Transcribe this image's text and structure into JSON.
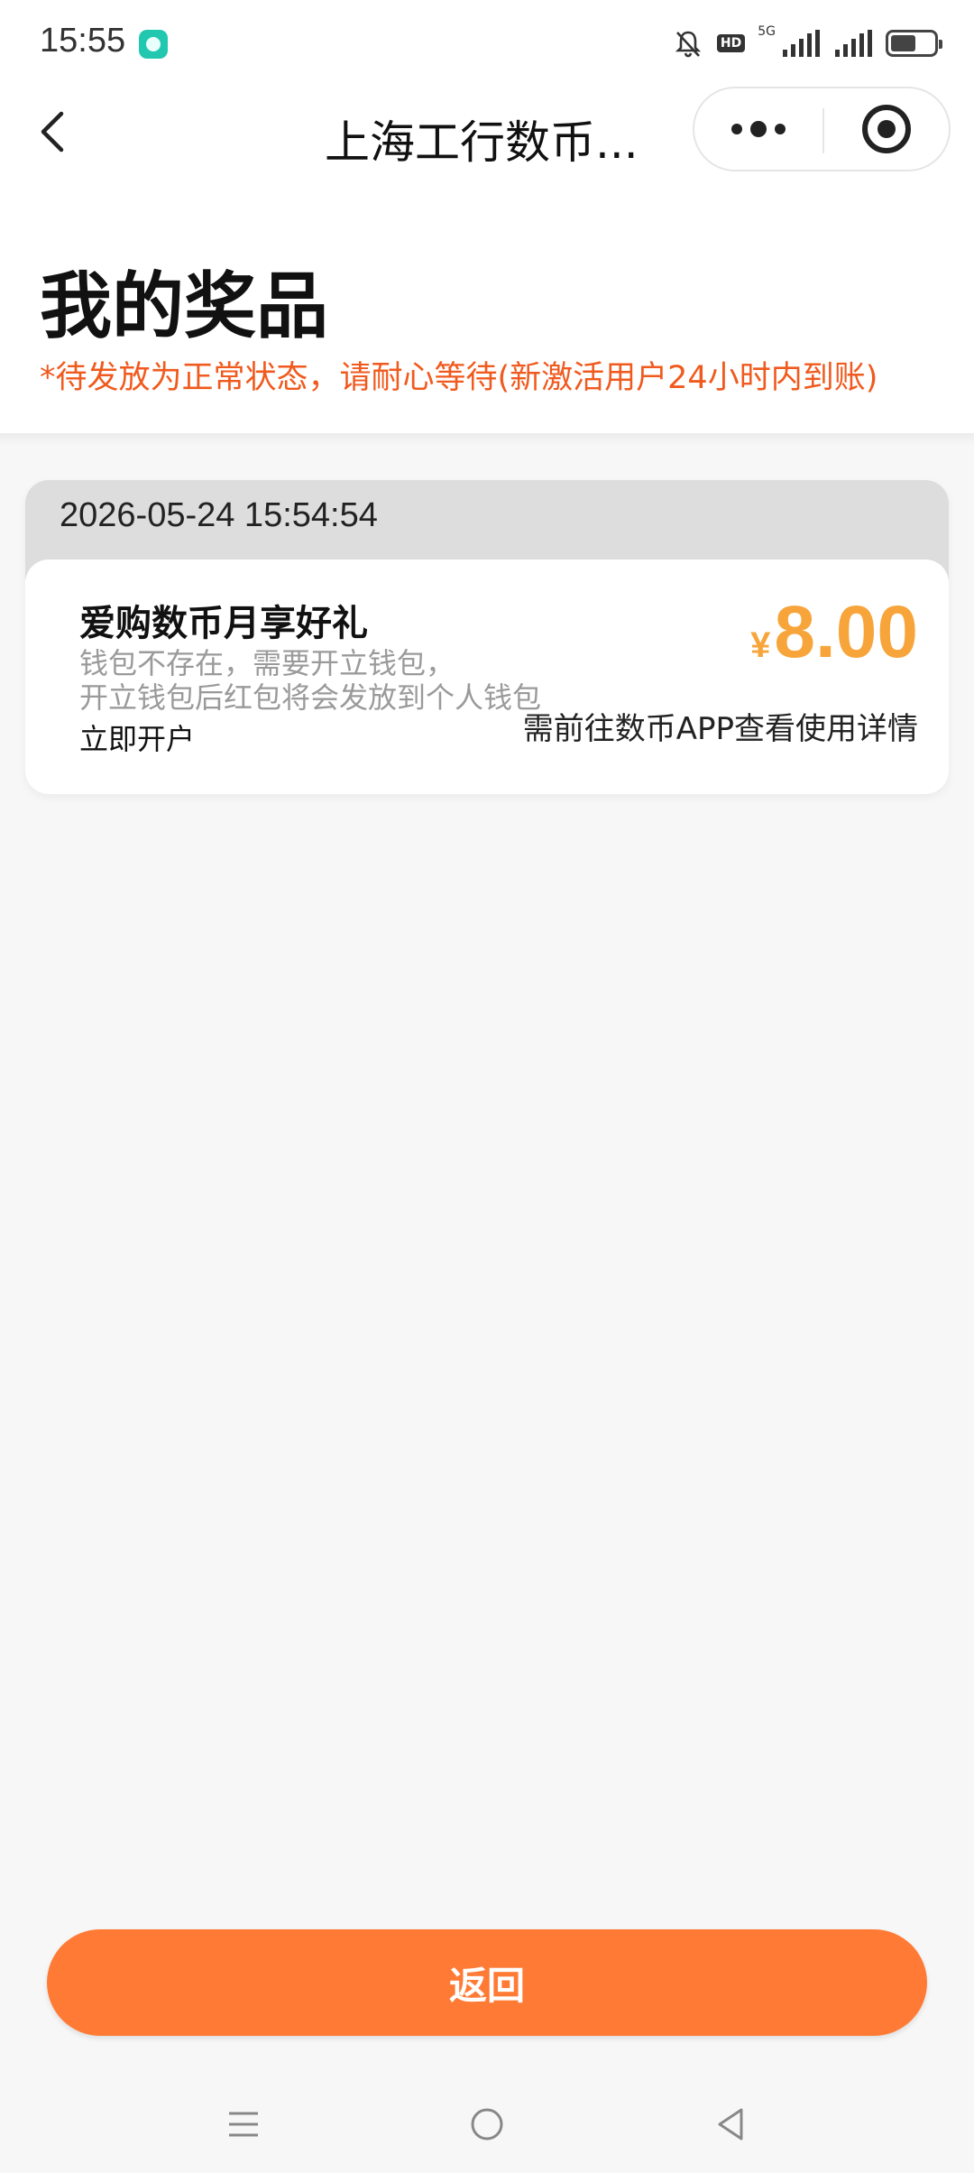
{
  "status_bar": {
    "time": "15:55",
    "hd_label": "HD",
    "network_label": "5G",
    "battery_level": 0.58
  },
  "nav": {
    "title": "上海工行数币..."
  },
  "header": {
    "title": "我的奖品",
    "notice": "*待发放为正常状态，请耐心等待(新激活用户24小时内到账)"
  },
  "prize": {
    "timestamp": "2026-05-24 15:54:54",
    "name": "爱购数币月享好礼",
    "desc_line1": "钱包不存在，需要开立钱包，",
    "desc_line2": "开立钱包后红包将会发放到个人钱包",
    "action": "立即开户",
    "currency": "¥",
    "amount": "8.00",
    "hint": "需前往数币APP查看使用详情"
  },
  "footer": {
    "return_label": "返回"
  },
  "colors": {
    "accent_orange": "#ff7b35",
    "notice_red": "#f05a1e",
    "price_gold": "#f7a53b"
  },
  "icons": {
    "back": "chevron-left-icon",
    "more": "more-dots-icon",
    "close": "target-close-icon"
  }
}
